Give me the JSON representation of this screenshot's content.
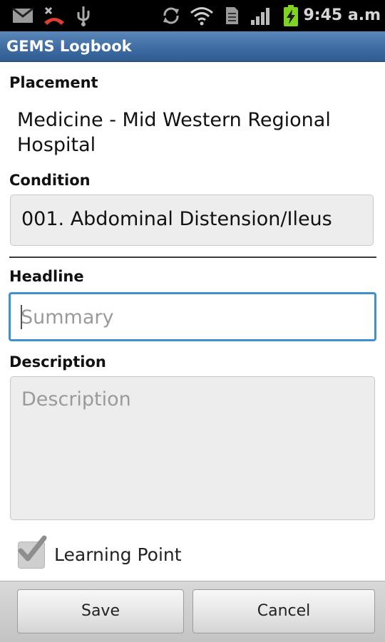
{
  "status_bar": {
    "time": "9:45 a.m",
    "icons": [
      "gmail-icon",
      "missed-call-icon",
      "usb-icon",
      "sync-icon",
      "wifi-icon",
      "sd-card-icon",
      "signal-icon",
      "battery-charging-icon"
    ]
  },
  "app": {
    "title": "GEMS Logbook"
  },
  "form": {
    "placement_label": "Placement",
    "placement_value": "Medicine - Mid Western Regional Hospital",
    "condition_label": "Condition",
    "condition_value": "001. Abdominal Distension/Ileus",
    "headline_label": "Headline",
    "headline_placeholder": "Summary",
    "description_label": "Description",
    "description_placeholder": "Description",
    "learning_point_label": "Learning Point",
    "learning_point_checked": true
  },
  "actions": {
    "save": "Save",
    "cancel": "Cancel"
  },
  "colors": {
    "title_bar": "#3f6da3",
    "focus_border": "#3d8fd6",
    "battery": "#7fd321"
  }
}
